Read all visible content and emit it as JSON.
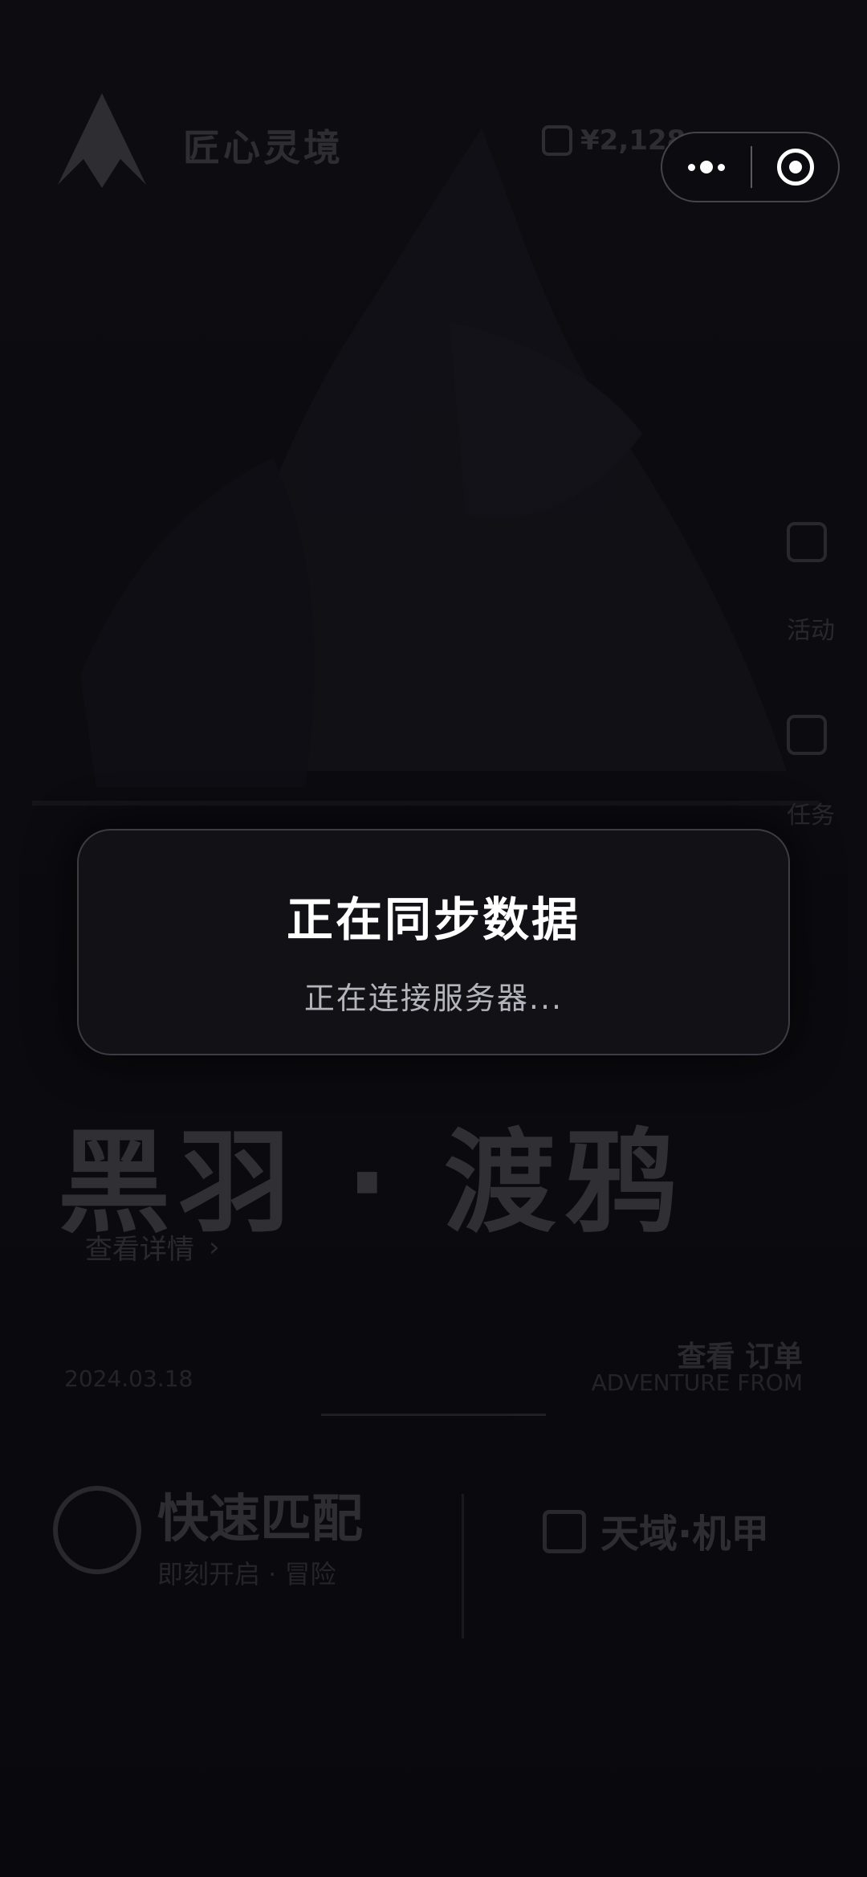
{
  "app_header": {
    "name": "匠心灵境",
    "coin_text": "¥2,128"
  },
  "hero": {
    "title": "黑羽 · 渡鸦",
    "link": "查看详情",
    "link_arrow": "›"
  },
  "meta": {
    "left": "2024.03.18",
    "right_title": "查看 订单",
    "right_sub": "ADVENTURE FROM"
  },
  "cards": [
    {
      "title": "快速匹配",
      "subtitle": "即刻开启 · 冒险"
    },
    {
      "title": "天域·机甲"
    }
  ],
  "side_labels": [
    "活动",
    "任务"
  ],
  "capsule": {
    "more_icon": "more-dots-icon",
    "close_icon": "target-close-icon"
  },
  "modal": {
    "title": "正在同步数据",
    "message": "正在连接服务器..."
  }
}
